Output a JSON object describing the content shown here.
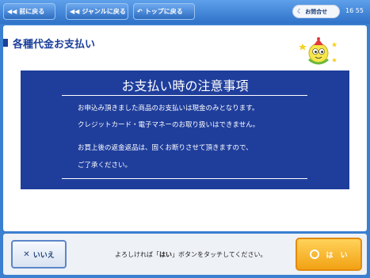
{
  "header": {
    "back_label": "前に戻る",
    "genre_back_label": "ジャンルに戻る",
    "top_back_label": "トップに戻る",
    "contact_label": "お問合せ",
    "clock": "16 55"
  },
  "main": {
    "page_title": "各種代金お支払い",
    "notice": {
      "title": "お支払い時の注意事項",
      "line1": "お申込み頂きました商品のお支払いは現金のみとなります。",
      "line2": "クレジットカード・電子マネーのお取り扱いはできません。",
      "line3": "お買上後の返金返品は、固くお断りさせて頂きますので、",
      "line4": "ご了承ください。"
    }
  },
  "footer": {
    "no_label": "いいえ",
    "instruction_before": "よろしければ「",
    "instruction_emph": "はい",
    "instruction_after": "」ボタンをタッチしてください。",
    "yes_label": "は　い"
  },
  "colors": {
    "accent_blue": "#1f3e9c",
    "top_bar": "#3a7fd0",
    "yes_orange": "#f2a214"
  },
  "icons": {
    "back": "double-left-arrow",
    "genre_back": "double-left-arrow",
    "top_back": "return-arrow",
    "contact": "speech-bubble",
    "no": "x-mark",
    "yes": "circle"
  }
}
